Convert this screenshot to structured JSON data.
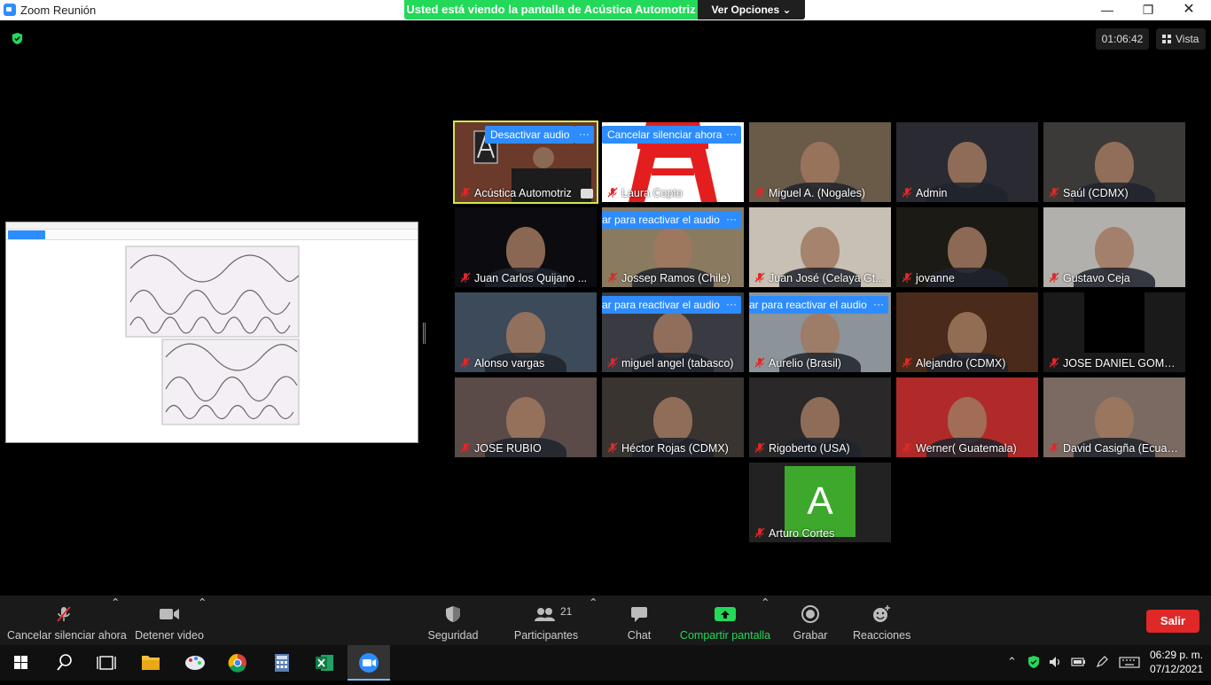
{
  "window": {
    "title": "Zoom Reunión"
  },
  "share_banner": {
    "message": "Usted está viendo la pantalla de Acústica Automotriz",
    "options_label": "Ver Opciones"
  },
  "header": {
    "timer": "01:06:42",
    "view_label": "Vista"
  },
  "participants": [
    {
      "name": "Acústica Automotriz",
      "overlay_label": "Desactivar audio",
      "bg": "#4a3a33"
    },
    {
      "name": "Laura Copto",
      "overlay_label": "Cancelar silenciar ahora",
      "bg": "#ffffff"
    },
    {
      "name": "Miguel A. (Nogales)",
      "overlay_label": "",
      "bg": "#6a5a48"
    },
    {
      "name": "Admin",
      "overlay_label": "",
      "bg": "#2a2a32"
    },
    {
      "name": "Saúl (CDMX)",
      "overlay_label": "",
      "bg": "#3c3a38"
    },
    {
      "name": "Juan Carlos Quijano ...",
      "overlay_label": "",
      "bg": "#0c0c10"
    },
    {
      "name": "Jossep Ramos (Chile)",
      "overlay_label": "ar para reactivar el audio",
      "bg": "#8a7a60"
    },
    {
      "name": "Juan José (Celaya Gt...",
      "overlay_label": "",
      "bg": "#c8c0b4"
    },
    {
      "name": "jovanne",
      "overlay_label": "",
      "bg": "#1c1a14"
    },
    {
      "name": "Gustavo Ceja",
      "overlay_label": "",
      "bg": "#b2b0ac"
    },
    {
      "name": "Alonso vargas",
      "overlay_label": "",
      "bg": "#3c4a5a"
    },
    {
      "name": "miguel angel (tabasco)",
      "overlay_label": "ar para reactivar el audio",
      "bg": "#3a3a42"
    },
    {
      "name": "Aurelio (Brasil)",
      "overlay_label": "ar para reactivar el audio",
      "bg": "#8c949a"
    },
    {
      "name": "Alejandro (CDMX)",
      "overlay_label": "",
      "bg": "#4a2a1a"
    },
    {
      "name": "JOSE DANIEL GOMEZ...",
      "overlay_label": "",
      "bg": "#1a1a1a"
    },
    {
      "name": "JOSE RUBIO",
      "overlay_label": "",
      "bg": "#5a4a48"
    },
    {
      "name": "Héctor Rojas (CDMX)",
      "overlay_label": "",
      "bg": "#3a3430"
    },
    {
      "name": "Rigoberto (USA)",
      "overlay_label": "",
      "bg": "#2a2828"
    },
    {
      "name": "Werner( Guatemala)",
      "overlay_label": "",
      "bg": "#b02a2a"
    },
    {
      "name": "David Casigña (Ecuad...",
      "overlay_label": "",
      "bg": "#7a6a62"
    },
    {
      "name": "Arturo Cortes",
      "overlay_label": "",
      "avatar_letter": "A",
      "bg": "#222222"
    }
  ],
  "toolbar": {
    "mute_label": "Cancelar silenciar ahora",
    "video_label": "Detener video",
    "security_label": "Seguridad",
    "participants_label": "Participantes",
    "participants_count": "21",
    "chat_label": "Chat",
    "share_label": "Compartir pantalla",
    "record_label": "Grabar",
    "reactions_label": "Reacciones",
    "leave_label": "Salir"
  },
  "taskbar": {
    "time": "06:29 p. m.",
    "date": "07/12/2021"
  }
}
